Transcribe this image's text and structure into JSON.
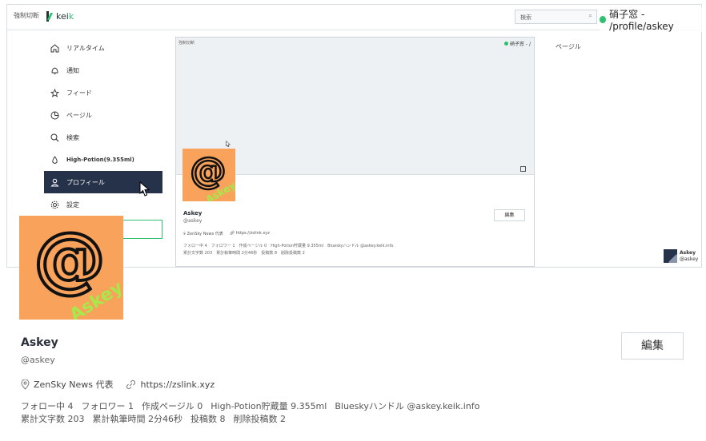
{
  "topbar": {
    "force_cut": "強制切断",
    "logo_text": "kei",
    "logo_accent": "k",
    "search_placeholder": "検索",
    "search_icon": "search-icon"
  },
  "path_overlay": {
    "text": "硝子窓 - /profile/askey"
  },
  "nav": {
    "items": [
      {
        "label": "リアルタイム",
        "icon": "home-icon"
      },
      {
        "label": "通知",
        "icon": "bell-icon"
      },
      {
        "label": "フィード",
        "icon": "star-icon"
      },
      {
        "label": "ページル",
        "icon": "pie-icon"
      },
      {
        "label": "検索",
        "icon": "search-icon"
      },
      {
        "label": "High-Potion(9.355ml)",
        "icon": "drop-icon"
      },
      {
        "label": "プロフィール",
        "icon": "user-icon"
      },
      {
        "label": "設定",
        "icon": "gear-icon"
      }
    ],
    "active_index": 6
  },
  "inner": {
    "tag": "強制切断",
    "status": "硝子窓 - /",
    "edit": "編集",
    "name": "Askey",
    "handle": "@askey",
    "link1": "ZenSky News 代表",
    "link2": "https://zslink.xyz",
    "stats_line1": "フォロー中 4　フォロワー 1　作成ページル 0　High-Potion貯蔵量 9.355ml　Blueskyハンドル @askey.keik.info",
    "stats_line2": "累計文字数 203　累計執筆時間 2分46秒　投稿数 8　削除投稿数 2"
  },
  "right_col": {
    "page_label": "ページル",
    "mini_user_name": "Askey",
    "mini_user_handle": "@askey"
  },
  "profile": {
    "name": "Askey",
    "handle": "@askey",
    "edit_label": "編集",
    "location": "ZenSky News 代表",
    "url": "https://zslink.xyz",
    "stats": [
      "フォロー中 4",
      "フォロワー 1",
      "作成ページル 0",
      "High-Potion貯蔵量 9.355ml",
      "Blueskyハンドル @askey.keik.info"
    ],
    "stats2": [
      "累計文字数 203",
      "累計執筆時間 2分46秒",
      "投稿数 8",
      "削除投稿数 2"
    ],
    "avatar_overlay_text": "Askey"
  },
  "colors": {
    "accent": "#2fbf71",
    "nav_active": "#25324a",
    "avatar_bg": "#f8a25b"
  }
}
